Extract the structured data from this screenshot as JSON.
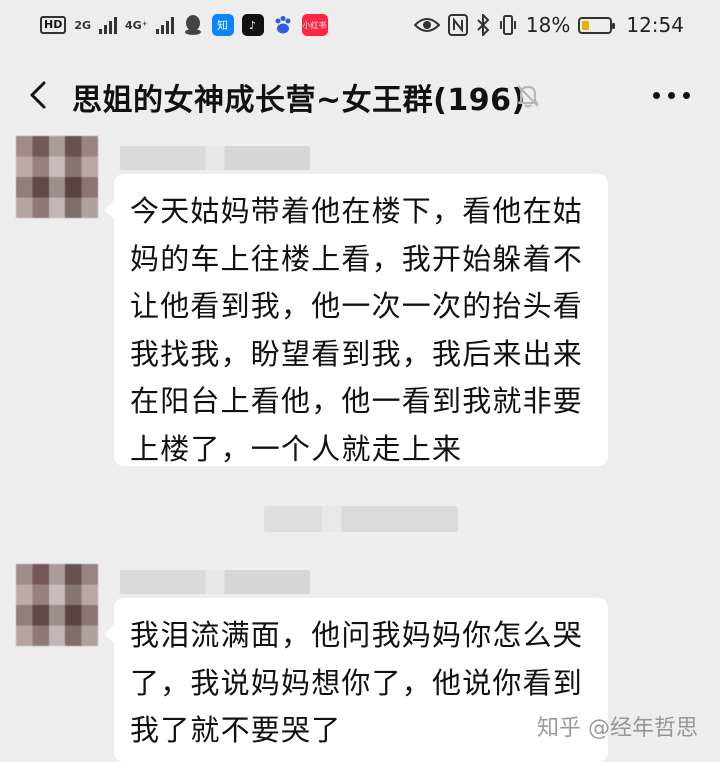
{
  "status_bar": {
    "hd": "HD",
    "net1": "2G",
    "net2": "4G⁺",
    "battery_percent": "18%",
    "time": "12:54",
    "app_icons": [
      {
        "name": "qq-icon",
        "label": "",
        "color": "#444444"
      },
      {
        "name": "zhihu-icon",
        "label": "知",
        "color": "#0a84ff"
      },
      {
        "name": "tiktok-icon",
        "label": "♪",
        "color": "#111111"
      },
      {
        "name": "baidu-icon",
        "label": "🐾",
        "color": "#2d5be3"
      },
      {
        "name": "xiaohongshu-icon",
        "label": "小红书",
        "color": "#ff2442"
      }
    ]
  },
  "header": {
    "title": "思姐的女神成长营~女王群(196)",
    "back_icon": "chevron-left-icon",
    "mute_icon": "bell-muted-icon",
    "more_icon": "more-dots-icon"
  },
  "messages": [
    {
      "text": "今天姑妈带着他在楼下，看他在姑妈的车上往楼上看，我开始躲着不让他看到我，他一次一次的抬头看我找我，盼望看到我，我后来出来在阳台上看他，他一看到我就非要上楼了，一个人就走上来"
    },
    {
      "text": "我泪流满面，他问我妈妈你怎么哭了，我说妈妈想你了，他说你看到我了就不要哭了"
    }
  ],
  "watermark": "知乎 @经年哲思",
  "colors": {
    "background": "#ededed",
    "bubble": "#ffffff",
    "text": "#111111"
  }
}
